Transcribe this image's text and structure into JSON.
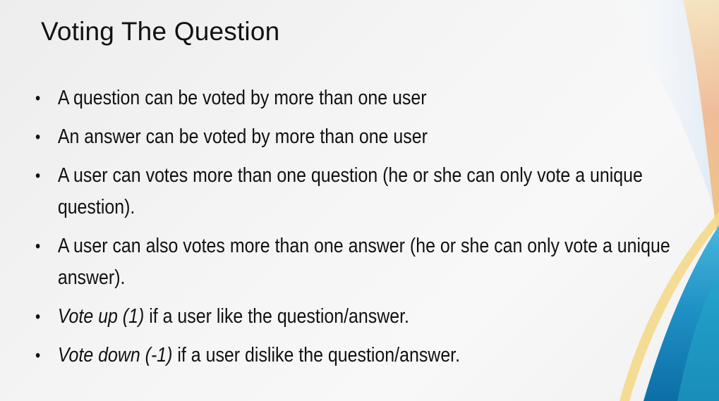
{
  "slide": {
    "title": "Voting The Question",
    "bullets": [
      {
        "text": "A question can be voted by more than one user"
      },
      {
        "text": "An answer can be voted by more than one user"
      },
      {
        "text": "A user can votes more than one question (he or she can only vote a unique question)."
      },
      {
        "text": "A user can also votes more than one answer (he or she can only vote a unique answer)."
      },
      {
        "emphasis": "Vote up (1)",
        "text": " if a user like the question/answer."
      },
      {
        "emphasis": "Vote down (-1)",
        "text": " if a user dislike the question/answer."
      }
    ],
    "bullet_glyph": "•"
  },
  "colors": {
    "background": "#f3f3f3",
    "text": "#111111",
    "wave_yellow": "#f5d98a",
    "wave_orange": "#f2b48a",
    "wave_blue": "#1e8fc4",
    "wave_teal": "#22a7c9"
  }
}
